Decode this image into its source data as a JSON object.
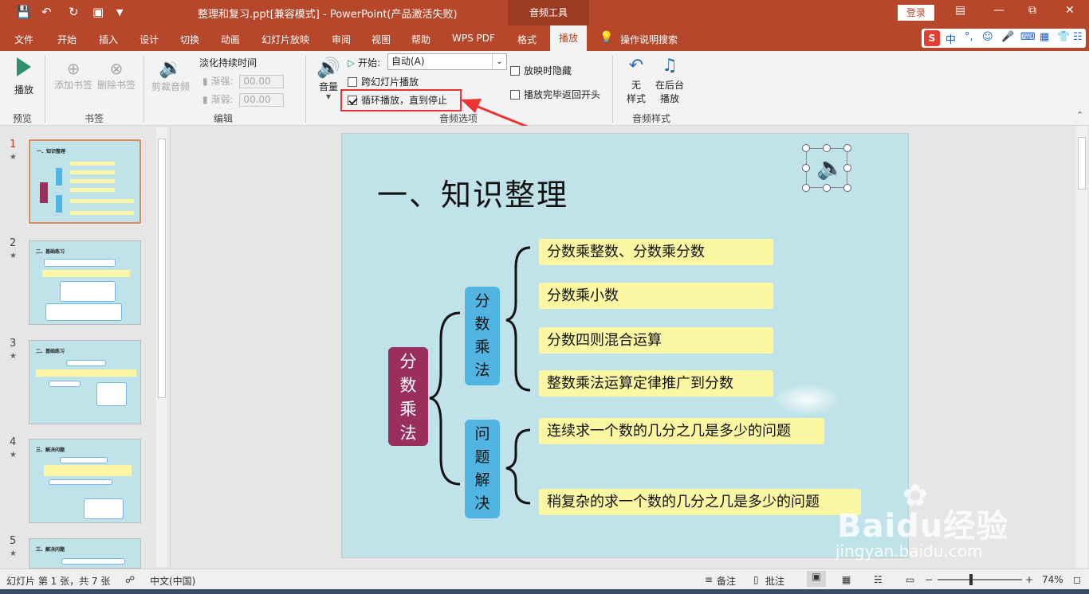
{
  "window": {
    "title": "整理和复习.ppt[兼容模式] - PowerPoint(产品激活失败)",
    "context_tab": "音频工具",
    "login": "登录"
  },
  "menu": {
    "items": [
      "文件",
      "开始",
      "插入",
      "设计",
      "切换",
      "动画",
      "幻灯片放映",
      "审阅",
      "视图",
      "帮助",
      "WPS PDF",
      "格式"
    ],
    "active": "播放",
    "search": "操作说明搜索"
  },
  "ime": {
    "mode": "中"
  },
  "ribbon": {
    "preview": {
      "play": "播放",
      "group": "预览"
    },
    "bookmarks": {
      "add": "添加书签",
      "remove": "删除书签",
      "group": "书签"
    },
    "edit": {
      "trim": "剪裁音频",
      "fade_title": "淡化持续时间",
      "fade_in": "渐强:",
      "fade_out": "渐弱:",
      "fade_in_value": "00.00",
      "fade_out_value": "00.00",
      "group": "编辑"
    },
    "audio_options": {
      "volume": "音量",
      "start_label": "开始:",
      "start_value": "自动(A)",
      "cross_slides": "跨幻灯片播放",
      "loop": "循环播放，直到停止",
      "loop_checked": true,
      "hide": "放映时隐藏",
      "rewind": "播放完毕返回开头",
      "group": "音频选项"
    },
    "audio_styles": {
      "none_line1": "无",
      "none_line2": "样式",
      "bg_line1": "在后台",
      "bg_line2": "播放",
      "group": "音频样式"
    }
  },
  "thumbnails": [
    {
      "num": "1",
      "star": "★",
      "title": "一、知识整理"
    },
    {
      "num": "2",
      "star": "★",
      "title": "二、基础练习"
    },
    {
      "num": "3",
      "star": "★",
      "title": "二、基础练习"
    },
    {
      "num": "4",
      "star": "★",
      "title": "三、解决问题"
    },
    {
      "num": "5",
      "star": "★",
      "title": "三、解决问题"
    }
  ],
  "slide": {
    "title": "一、知识整理",
    "root": [
      "分",
      "数",
      "乘",
      "法"
    ],
    "branch1": [
      "分",
      "数",
      "乘",
      "法"
    ],
    "branch2": [
      "问",
      "题",
      "解",
      "决"
    ],
    "leaves1": [
      "分数乘整数、分数乘分数",
      "分数乘小数",
      "分数四则混合运算",
      "整数乘法运算定律推广到分数"
    ],
    "leaves2": [
      "连续求一个数的几分之几是多少的问题",
      "稍复杂的求一个数的几分之几是多少的问题"
    ]
  },
  "status": {
    "slide_info": "幻灯片 第 1 张，共 7 张",
    "language": "中文(中国)",
    "notes": "备注",
    "comments": "批注",
    "zoom": "74%"
  },
  "watermark": {
    "brand": "Baidu经验",
    "url": "jingyan.baidu.com"
  },
  "colors": {
    "accent": "#b7472a",
    "slide_bg": "#bfe3e8",
    "root_box": "#9a2f5e",
    "branch_box": "#52b4e3",
    "leaf_bg": "#fcf7a2",
    "highlight": "#ee3333"
  }
}
